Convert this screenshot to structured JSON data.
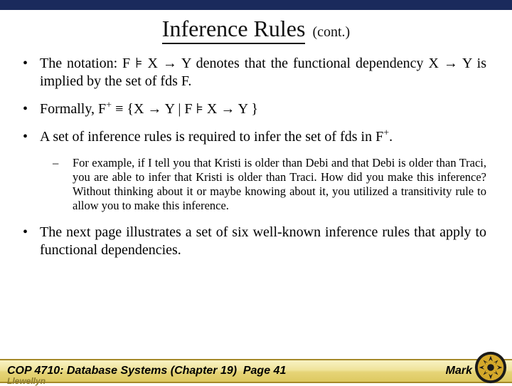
{
  "title": {
    "main": "Inference Rules",
    "cont": "(cont.)"
  },
  "bullets": {
    "b1a": "The notation: F ",
    "b1_models": "⊧",
    "b1b": " X ",
    "arrow": "→",
    "b1c": " Y denotes that the functional dependency X ",
    "b1d": " Y is implied by the set of fds F.",
    "b2a": "Formally, F",
    "plus": "+",
    "b2_equiv": " ≡ {X ",
    "b2b": " Y | F ",
    "b2c": " X ",
    "b2d": " Y }",
    "b3a": "A set of inference rules is required to infer the set of fds in F",
    "b3b": ".",
    "sub1": "For example, if I tell you that Kristi is older than Debi and that Debi is older than Traci, you are able to infer that Kristi is older than Traci.  How did you make this inference?  Without thinking about it or maybe knowing about it, you utilized a transitivity rule to allow you to make this inference.",
    "b4": "The next page illustrates a set of six well-known inference rules that apply to functional dependencies."
  },
  "footer": {
    "left": "COP 4710: Database Systems  (Chapter 19)",
    "center": "Page 41",
    "right": "Mark",
    "below": "Llewellyn"
  }
}
